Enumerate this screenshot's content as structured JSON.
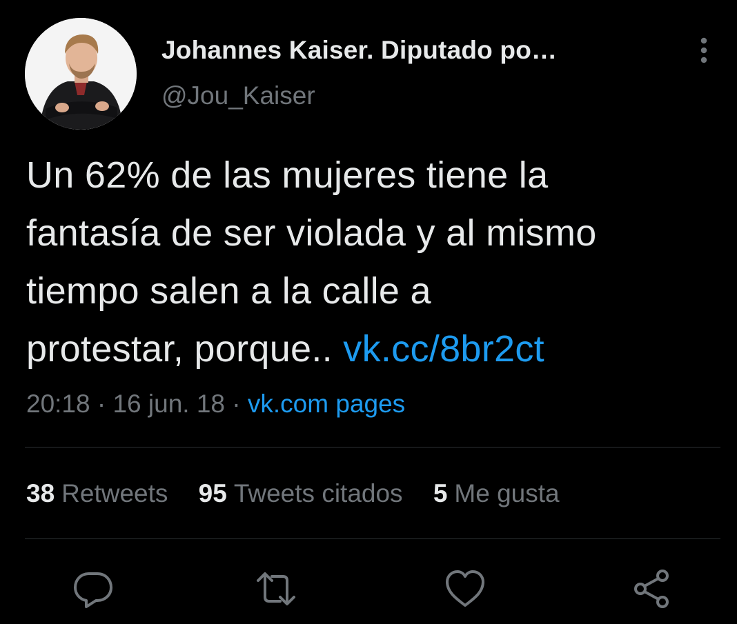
{
  "author": {
    "display_name": "Johannes Kaiser. Diputado po…",
    "handle": "@Jou_Kaiser"
  },
  "tweet": {
    "text_lines": [
      "Un 62% de las mujeres tiene la",
      "fantasía de ser violada y al mismo",
      "tiempo salen a la calle a",
      "protestar, porque.. "
    ],
    "link": "vk.cc/8br2ct",
    "time": "20:18",
    "separator": "·",
    "date": "16 jun. 18",
    "source": "vk.com pages"
  },
  "stats": {
    "retweets": {
      "count": "38",
      "label": "Retweets"
    },
    "quotes": {
      "count": "95",
      "label": "Tweets citados"
    },
    "likes": {
      "count": "5",
      "label": "Me gusta"
    }
  },
  "icons": {
    "more": "more-vertical-icon",
    "reply": "reply-icon",
    "retweet": "retweet-icon",
    "like": "heart-icon",
    "share": "share-icon"
  },
  "colors": {
    "background": "#000000",
    "text": "#e7e9ea",
    "secondary": "#71767b",
    "link": "#1d9bf0",
    "divider": "#2f3336"
  }
}
